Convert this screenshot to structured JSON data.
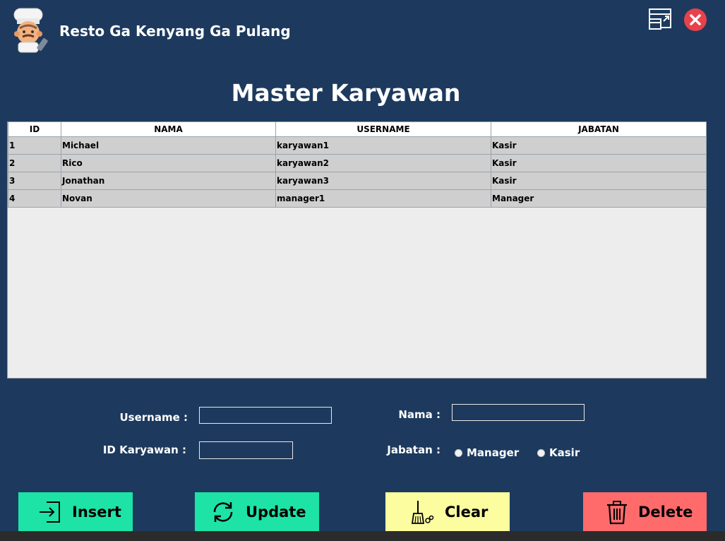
{
  "header": {
    "app_title": "Resto Ga Kenyang Ga Pulang",
    "logo_icon": "chef-icon",
    "maximize_icon": "restore-window-icon",
    "close_icon": "close-circle-icon"
  },
  "page": {
    "title": "Master Karyawan"
  },
  "table": {
    "columns": [
      "ID",
      "NAMA",
      "USERNAME",
      "JABATAN"
    ],
    "rows": [
      [
        "1",
        "Michael",
        "karyawan1",
        "Kasir"
      ],
      [
        "2",
        "Rico",
        "karyawan2",
        "Kasir"
      ],
      [
        "3",
        "Jonathan",
        "karyawan3",
        "Kasir"
      ],
      [
        "4",
        "Novan",
        "manager1",
        "Manager"
      ]
    ]
  },
  "form": {
    "username_label": "Username :",
    "username_value": "",
    "nama_label": "Nama :",
    "nama_value": "",
    "id_label": "ID Karyawan :",
    "id_value": "",
    "jabatan_label": "Jabatan :",
    "jabatan_options": [
      "Manager",
      "Kasir"
    ]
  },
  "actions": {
    "insert": "Insert",
    "update": "Update",
    "clear": "Clear",
    "delete": "Delete"
  },
  "colors": {
    "background": "#1d3a5e",
    "insert_button": "#1de3a6",
    "update_button": "#1de3a6",
    "clear_button": "#fbfd9e",
    "delete_button": "#ff6b6b",
    "close_icon": "#e8414a"
  }
}
